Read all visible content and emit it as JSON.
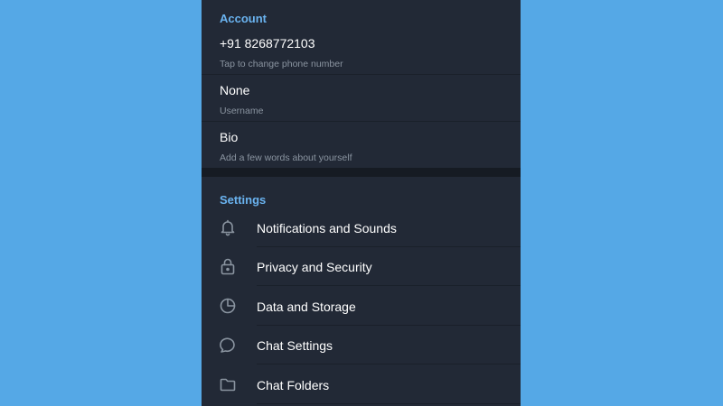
{
  "account": {
    "header": "Account",
    "phone": {
      "value": "+91 8268772103",
      "hint": "Tap to change phone number"
    },
    "username": {
      "value": "None",
      "hint": "Username"
    },
    "bio": {
      "value": "Bio",
      "hint": "Add a few words about yourself"
    }
  },
  "settings": {
    "header": "Settings",
    "items": [
      {
        "label": "Notifications and Sounds",
        "icon": "bell-icon"
      },
      {
        "label": "Privacy and Security",
        "icon": "lock-icon"
      },
      {
        "label": "Data and Storage",
        "icon": "pie-chart-icon"
      },
      {
        "label": "Chat Settings",
        "icon": "chat-bubble-icon"
      },
      {
        "label": "Chat Folders",
        "icon": "folder-icon"
      }
    ]
  },
  "colors": {
    "background": "#55a8e6",
    "panel": "#222936",
    "accent": "#6ab3f0",
    "text_primary": "#ffffff",
    "text_secondary": "#8a94a0"
  }
}
